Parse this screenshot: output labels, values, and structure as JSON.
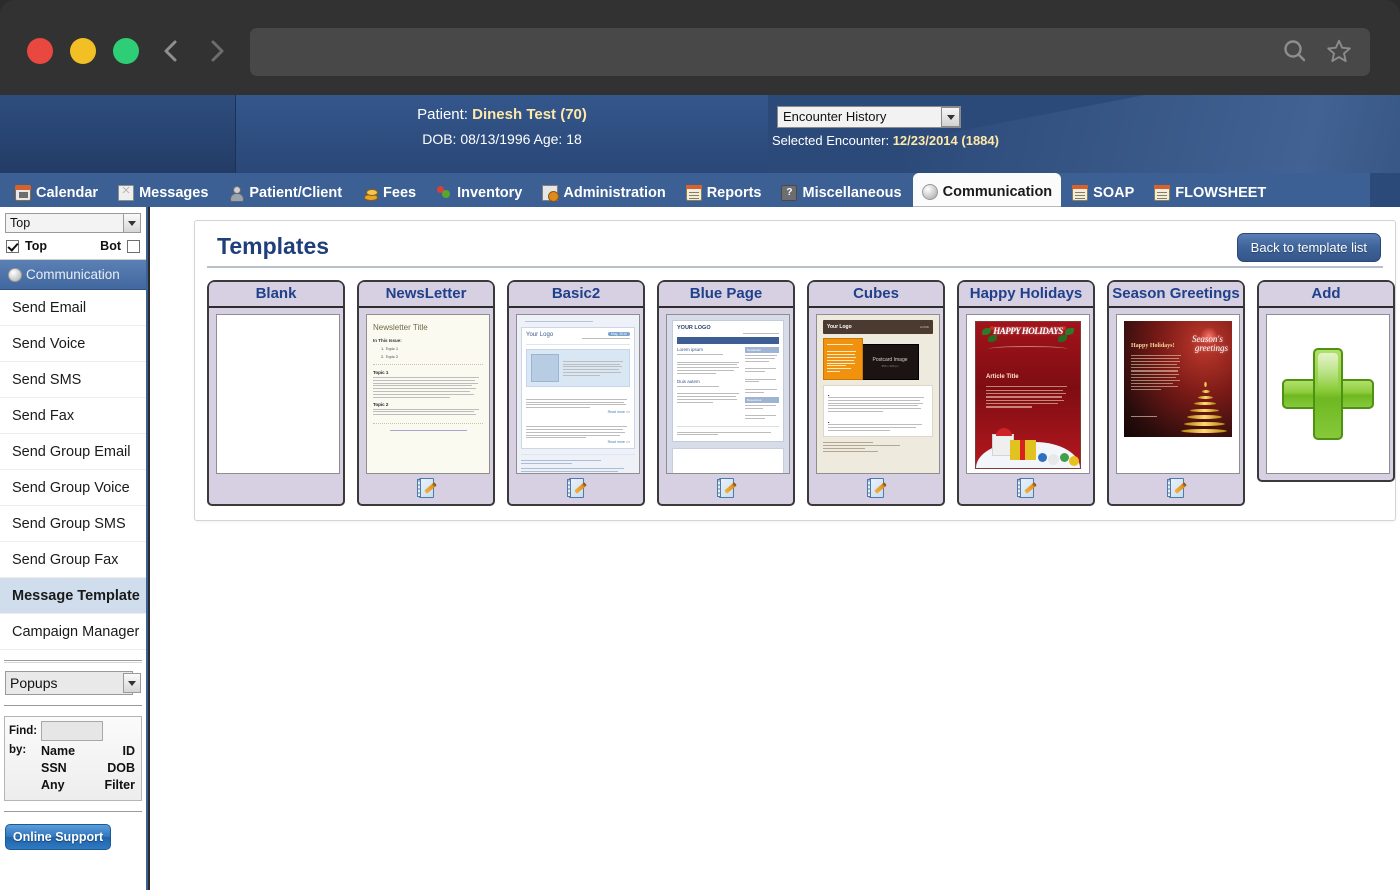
{
  "browser": {
    "traffic_lights": [
      "close",
      "minimize",
      "maximize"
    ],
    "back_label": "Back",
    "forward_label": "Forward",
    "url_value": "",
    "url_placeholder": ""
  },
  "header": {
    "patient_label": "Patient:",
    "patient_name": "Dinesh Test (70)",
    "dob_line": "DOB: 08/13/1996 Age: 18",
    "encounter_select_value": "Encounter History",
    "encounter_options": [
      "Encounter History"
    ],
    "selected_encounter_label": "Selected Encounter:",
    "selected_encounter_value": "12/23/2014 (1884)"
  },
  "tabs": [
    {
      "label": "Calendar",
      "icon": "calendar-icon",
      "active": false
    },
    {
      "label": "Messages",
      "icon": "envelope-icon",
      "active": false
    },
    {
      "label": "Patient/Client",
      "icon": "person-icon",
      "active": false
    },
    {
      "label": "Fees",
      "icon": "coins-icon",
      "active": false
    },
    {
      "label": "Inventory",
      "icon": "flower-icon",
      "active": false
    },
    {
      "label": "Administration",
      "icon": "admin-gear-icon",
      "active": false
    },
    {
      "label": "Reports",
      "icon": "reports-icon",
      "active": false
    },
    {
      "label": "Miscellaneous",
      "icon": "help-icon",
      "active": false
    },
    {
      "label": "Communication",
      "icon": "communication-icon",
      "active": true
    },
    {
      "label": "SOAP",
      "icon": "soap-icon",
      "active": false
    },
    {
      "label": "FLOWSHEET",
      "icon": "flowsheet-icon",
      "active": false
    }
  ],
  "sidebar": {
    "position_select_value": "Top",
    "position_options": [
      "Top"
    ],
    "top_checkbox_label": "Top",
    "top_checkbox_checked": true,
    "bot_checkbox_label": "Bot",
    "bot_checkbox_checked": false,
    "group_header": "Communication",
    "items": [
      {
        "label": "Send Email",
        "selected": false
      },
      {
        "label": "Send Voice",
        "selected": false
      },
      {
        "label": "Send SMS",
        "selected": false
      },
      {
        "label": "Send Fax",
        "selected": false
      },
      {
        "label": "Send Group Email",
        "selected": false
      },
      {
        "label": "Send Group Voice",
        "selected": false
      },
      {
        "label": "Send Group SMS",
        "selected": false
      },
      {
        "label": "Send Group Fax",
        "selected": false
      },
      {
        "label": "Message Template",
        "selected": true
      },
      {
        "label": "Campaign Manager",
        "selected": false
      }
    ],
    "popups_select_value": "Popups",
    "popups_options": [
      "Popups"
    ],
    "find": {
      "find_label": "Find:",
      "find_value": "",
      "by_label": "by:",
      "options": [
        [
          "Name",
          "ID"
        ],
        [
          "SSN",
          "DOB"
        ],
        [
          "Any",
          "Filter"
        ]
      ]
    },
    "support_button": "Online Support"
  },
  "main": {
    "panel_title": "Templates",
    "back_button": "Back to template list",
    "templates": [
      {
        "name": "Blank",
        "kind": "blank",
        "has_edit": false
      },
      {
        "name": "NewsLetter",
        "kind": "newsletter",
        "has_edit": true
      },
      {
        "name": "Basic2",
        "kind": "basic2",
        "has_edit": true
      },
      {
        "name": "Blue Page",
        "kind": "bluepage",
        "has_edit": true
      },
      {
        "name": "Cubes",
        "kind": "cubes",
        "has_edit": true
      },
      {
        "name": "Happy Holidays",
        "kind": "happyholidays",
        "has_edit": true
      },
      {
        "name": "Season Greetings",
        "kind": "seasongreetings",
        "has_edit": true
      },
      {
        "name": "Add",
        "kind": "add",
        "has_edit": false
      }
    ],
    "thumbs": {
      "newsletter": {
        "title": "Newsletter Title",
        "subhead": "In This Issue:",
        "items": [
          "1.  Topic 1",
          "2.  Topic 2"
        ],
        "headings": [
          "Topic 1",
          "Topic 2"
        ]
      },
      "basic2": {
        "logo": "Your Logo",
        "date_pill": "May, 2010",
        "read_more": "Read more >>"
      },
      "bluepage": {
        "logo": "YOUR LOGO",
        "side_heads": [
          "Newsletter",
          "Resources"
        ],
        "headings": [
          "Lorem ipsum",
          "Duis autem"
        ]
      },
      "cubes": {
        "logo": "Your Logo",
        "nav": "HOME",
        "postcard_title": "Postcard Image",
        "postcard_sub": "350 x 200 px"
      },
      "happyholidays": {
        "banner": "HAPPY HOLIDAYS",
        "heading": "Article Title"
      },
      "seasongreetings": {
        "heading": "Happy Holidays!",
        "script_line1": "Season's",
        "script_line2": "greetings"
      }
    },
    "edit_icon_name": "edit-template-icon"
  },
  "colors": {
    "header_blue": "#2c4a79",
    "tabbar_blue": "#3c6094",
    "card_lavender": "#d7d0e2",
    "title_blue": "#1f3f7a",
    "accent_yellow": "#ffe9a8",
    "plus_green": "#8ccc3c"
  }
}
